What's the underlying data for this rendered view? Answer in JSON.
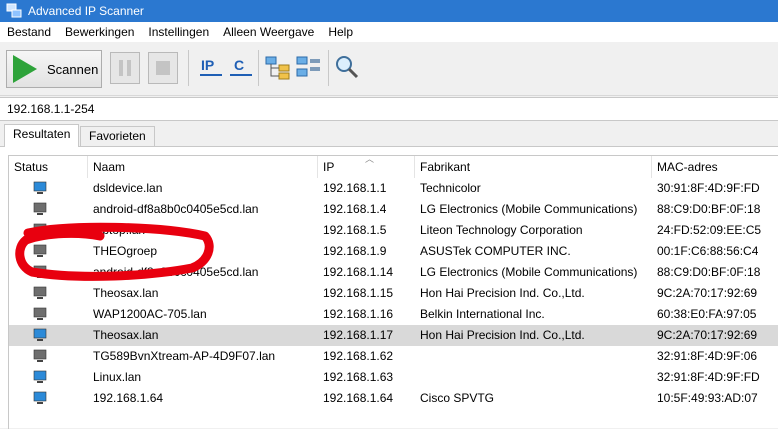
{
  "window": {
    "title": "Advanced IP Scanner"
  },
  "menu": [
    "Bestand",
    "Bewerkingen",
    "Instellingen",
    "Alleen Weergave",
    "Help"
  ],
  "toolbar": {
    "scan_label": "Scannen",
    "ip_label": "IP",
    "c_label": "C"
  },
  "address": {
    "value": "192.168.1.1-254"
  },
  "tabs": [
    "Resultaten",
    "Favorieten"
  ],
  "columns": [
    "Status",
    "Naam",
    "IP",
    "Fabrikant",
    "MAC-adres"
  ],
  "rows": [
    {
      "status": "on",
      "name": "dsldevice.lan",
      "ip": "192.168.1.1",
      "vendor": "Technicolor",
      "mac": "30:91:8F:4D:9F:FD",
      "selected": false
    },
    {
      "status": "off",
      "name": "android-df8a8b0c0405e5cd.lan",
      "ip": "192.168.1.4",
      "vendor": "LG Electronics (Mobile Communications)",
      "mac": "88:C9:D0:BF:0F:18",
      "selected": false
    },
    {
      "status": "off",
      "name": "laptop.lan",
      "ip": "192.168.1.5",
      "vendor": "Liteon Technology Corporation",
      "mac": "24:FD:52:09:EE:C5",
      "selected": false
    },
    {
      "status": "off",
      "name": "THEOgroep",
      "ip": "192.168.1.9",
      "vendor": "ASUSTek COMPUTER INC.",
      "mac": "00:1F:C6:88:56:C4",
      "selected": false
    },
    {
      "status": "off",
      "name": "android-df8a8b0c0405e5cd.lan",
      "ip": "192.168.1.14",
      "vendor": "LG Electronics (Mobile Communications)",
      "mac": "88:C9:D0:BF:0F:18",
      "selected": false
    },
    {
      "status": "off",
      "name": "Theosax.lan",
      "ip": "192.168.1.15",
      "vendor": "Hon Hai Precision Ind. Co.,Ltd.",
      "mac": "9C:2A:70:17:92:69",
      "selected": false
    },
    {
      "status": "off",
      "name": "WAP1200AC-705.lan",
      "ip": "192.168.1.16",
      "vendor": "Belkin International Inc.",
      "mac": "60:38:E0:FA:97:05",
      "selected": false
    },
    {
      "status": "on",
      "name": "Theosax.lan",
      "ip": "192.168.1.17",
      "vendor": "Hon Hai Precision Ind. Co.,Ltd.",
      "mac": "9C:2A:70:17:92:69",
      "selected": true
    },
    {
      "status": "off",
      "name": "TG589BvnXtream-AP-4D9F07.lan",
      "ip": "192.168.1.62",
      "vendor": "",
      "mac": "32:91:8F:4D:9F:06",
      "selected": false
    },
    {
      "status": "on",
      "name": "Linux.lan",
      "ip": "192.168.1.63",
      "vendor": "",
      "mac": "32:91:8F:4D:9F:FD",
      "selected": false
    },
    {
      "status": "on",
      "name": "192.168.1.64",
      "ip": "192.168.1.64",
      "vendor": "Cisco SPVTG",
      "mac": "10:5F:49:93:AD:07",
      "selected": false
    }
  ],
  "colors": {
    "titlebar": "#2b78d0",
    "scan_play": "#2ea33a",
    "selected_row": "#d9d9d9",
    "annotation": "#e8000f",
    "pc_on": "#2c8ad8",
    "pc_off": "#6e6e6e"
  }
}
